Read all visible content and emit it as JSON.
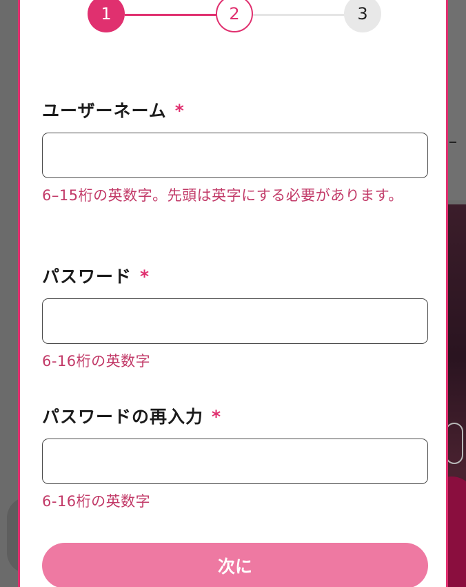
{
  "stepper": {
    "steps": [
      "1",
      "2",
      "3"
    ]
  },
  "form": {
    "username": {
      "label": "ユーザーネーム",
      "required_mark": "*",
      "hint": "6–15桁の英数字。先頭は英字にする必要があります。",
      "value": ""
    },
    "password": {
      "label": "パスワード",
      "required_mark": "*",
      "hint": "6-16桁の英数字",
      "value": ""
    },
    "password_confirm": {
      "label": "パスワードの再入力",
      "required_mark": "*",
      "hint": "6-16桁の英数字",
      "value": ""
    }
  },
  "actions": {
    "next_label": "次に"
  },
  "colors": {
    "accent": "#e0306f",
    "button": "#ee79a2",
    "hint": "#c23a68"
  }
}
